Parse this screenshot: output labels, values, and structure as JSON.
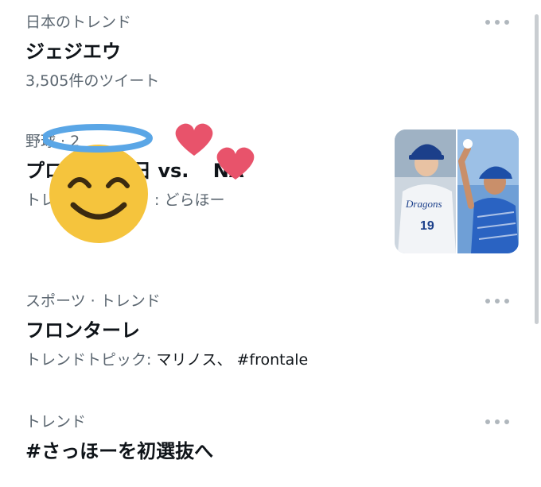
{
  "trends": [
    {
      "context": "日本のトレンド",
      "title": "ジェジエウ",
      "detail": "3,505件のツイート",
      "more_icon": "more-horizontal-icon"
    },
    {
      "context": "野球 · 2",
      "title": "プロ",
      "title_tail": "日 vs. ",
      "title_end": "NA",
      "detail_prefix": "トレ",
      "detail_tail": ": どらほー",
      "has_thumbnail": true
    },
    {
      "context": "スポーツ · トレンド",
      "title": "フロンターレ",
      "detail_label": "トレンドトピック: ",
      "detail_values": "マリノス、 #frontale",
      "more_icon": "more-horizontal-icon"
    },
    {
      "context": "トレンド",
      "title": "#さっほーを初選抜へ",
      "more_icon": "more-horizontal-icon"
    }
  ],
  "thumbnail": {
    "jersey_number": "19",
    "jersey_text": "Dragons"
  },
  "overlays": {
    "sticker": "smiling-face-with-halo-emoji",
    "hearts": "two-hearts-emoji"
  },
  "colors": {
    "primary_text": "#0f1419",
    "secondary_text": "#5b6670",
    "dots": "#b0b7bd",
    "heart": "#e8536b",
    "halo": "#5aa6e6",
    "face": "#f5c43d"
  }
}
